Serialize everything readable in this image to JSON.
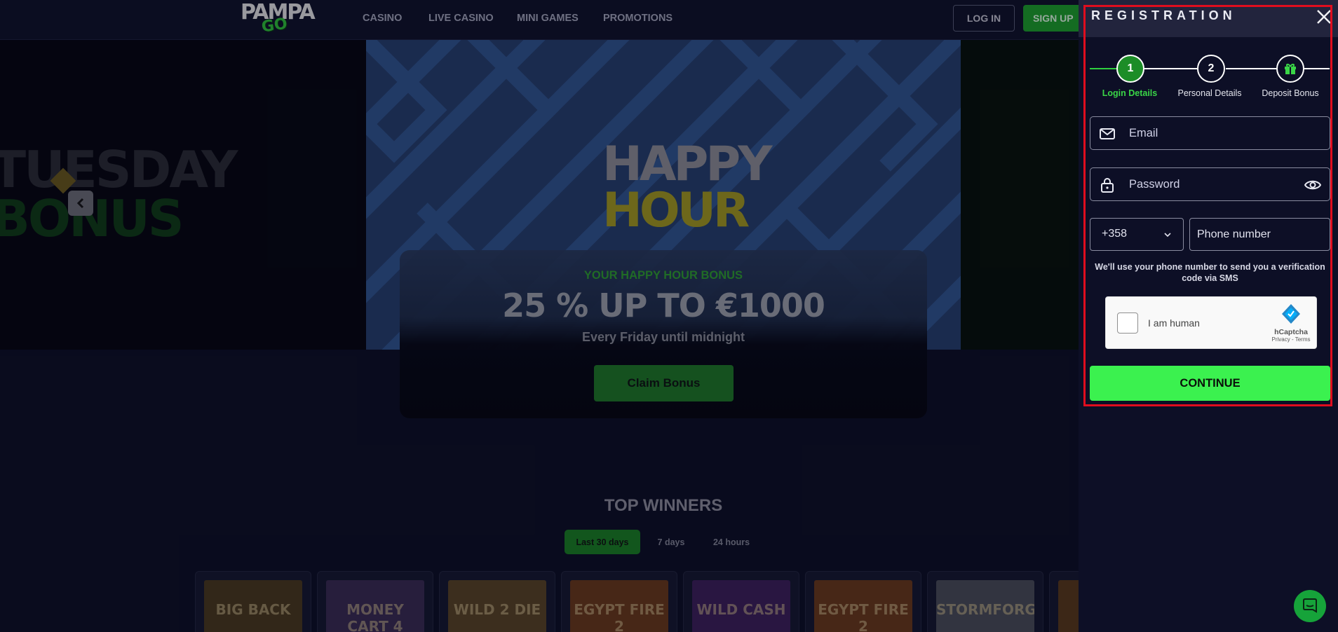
{
  "header": {
    "logo": {
      "top": "PAMPA",
      "bottom": "GO"
    },
    "nav": [
      "CASINO",
      "LIVE CASINO",
      "MINI GAMES",
      "PROMOTIONS"
    ],
    "login_label": "LOG IN",
    "signup_label": "SIGN UP"
  },
  "hero": {
    "side_banner": {
      "line1": "TUESDAY",
      "line2": "BONUS"
    },
    "banner_logo": {
      "line1": "HAPPY",
      "line2": "HOUR"
    },
    "promo": {
      "subtitle": "YOUR HAPPY HOUR BONUS",
      "headline": "25 % UP TO €1000",
      "description": "Every Friday until midnight",
      "cta": "Claim Bonus"
    }
  },
  "top_winners": {
    "title": "TOP WINNERS",
    "tabs": [
      "Last 30 days",
      "7 days",
      "24 hours"
    ],
    "active_tab": "Last 30 days",
    "games": [
      {
        "name": "BIG BACK",
        "color": "#4a3a1c"
      },
      {
        "name": "MONEY CART 4",
        "color": "#3a2c52"
      },
      {
        "name": "WILD 2 DIE",
        "color": "#5a4424"
      },
      {
        "name": "EGYPT FIRE 2",
        "color": "#6a3a1a"
      },
      {
        "name": "WILD CASH",
        "color": "#3d1f5a"
      },
      {
        "name": "EGYPT FIRE 2",
        "color": "#6a3a1a"
      },
      {
        "name": "STORMFORGED",
        "color": "#4a4e58"
      },
      {
        "name": "",
        "color": "#5a3a1a"
      }
    ]
  },
  "registration": {
    "title": "REGISTRATION",
    "steps": [
      {
        "number": "1",
        "label": "Login Details"
      },
      {
        "number": "2",
        "label": "Personal Details"
      },
      {
        "number": "",
        "label": "Deposit Bonus"
      }
    ],
    "email_placeholder": "Email",
    "password_placeholder": "Password",
    "country_code": "+358",
    "phone_placeholder": "Phone number",
    "sms_note": "We'll use your phone number to send you a verification code via SMS",
    "captcha": {
      "label": "I am human",
      "brand": "hCaptcha",
      "links": "Privacy - Terms"
    },
    "continue_label": "CONTINUE"
  },
  "colors": {
    "accent_green": "#3bf14f",
    "highlight_frame": "#e00d1e",
    "panel_bg": "#0d0f26"
  }
}
